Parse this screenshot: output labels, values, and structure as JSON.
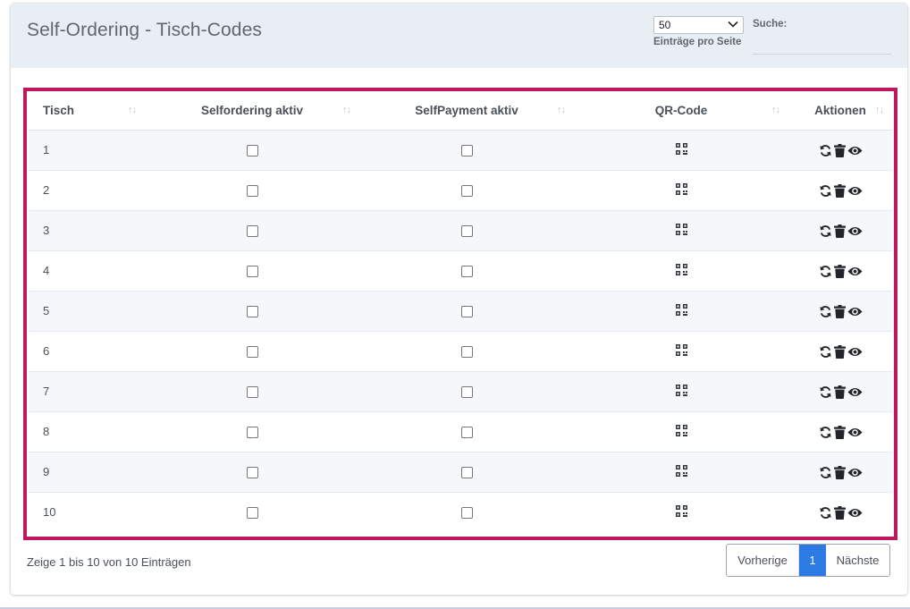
{
  "header": {
    "title": "Self-Ordering - Tisch-Codes",
    "length_value": "50",
    "length_label": "Einträge pro Seite",
    "search_label": "Suche:",
    "search_value": ""
  },
  "table": {
    "columns": [
      "Tisch",
      "Selfordering aktiv",
      "SelfPayment aktiv",
      "QR-Code",
      "Aktionen"
    ],
    "rows": [
      {
        "tisch": "1",
        "selfordering": false,
        "selfpayment": false
      },
      {
        "tisch": "2",
        "selfordering": false,
        "selfpayment": false
      },
      {
        "tisch": "3",
        "selfordering": false,
        "selfpayment": false
      },
      {
        "tisch": "4",
        "selfordering": false,
        "selfpayment": false
      },
      {
        "tisch": "5",
        "selfordering": false,
        "selfpayment": false
      },
      {
        "tisch": "6",
        "selfordering": false,
        "selfpayment": false
      },
      {
        "tisch": "7",
        "selfordering": false,
        "selfpayment": false
      },
      {
        "tisch": "8",
        "selfordering": false,
        "selfpayment": false
      },
      {
        "tisch": "9",
        "selfordering": false,
        "selfpayment": false
      },
      {
        "tisch": "10",
        "selfordering": false,
        "selfpayment": false
      }
    ],
    "row_icons": [
      "qr-code-icon",
      "refresh-icon",
      "trash-icon",
      "eye-icon"
    ],
    "highlight_color": "#c0185f"
  },
  "footer": {
    "info": "Zeige 1 bis 10 von 10 Einträgen",
    "prev_label": "Vorherige",
    "current_page": "1",
    "next_label": "Nächste",
    "accent_color": "#2c7be5"
  }
}
